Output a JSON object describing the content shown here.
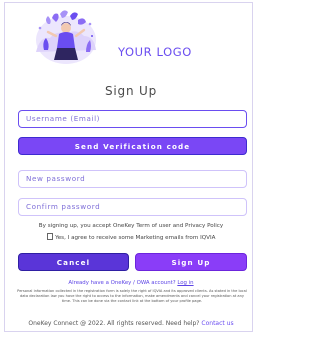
{
  "logo": {
    "text": "YOUR LOGO",
    "illustration": "person-with-plants-illustration",
    "accent_color": "#6a4df0"
  },
  "form": {
    "title": "Sign Up",
    "username_placeholder": "Username (Email)",
    "send_code_label": "Send Verification code",
    "new_password_placeholder": "New password",
    "confirm_password_placeholder": "Confirm password",
    "terms_text": "By signing up, you accept OneKey Term of user and Privacy Policy",
    "marketing_text": "Yes, I agree to receive some Marketing emails from IQVIA",
    "cancel_label": "Cancel",
    "signup_label": "Sign Up"
  },
  "links": {
    "already_prefix": "Already have a OneKey / OWA account? ",
    "login_label": "Log in"
  },
  "fine_print": "Personal information collected in the registration form is solely the right of IQVIA and its approved clients. As stated in the local data declaration law you have the right to access to the information, make amendments and cancel your registration at any time. This can be done via the contact link at the bottom of your profile page.",
  "footer": {
    "text": "OneKey Connect @ 2022. All rights reserved. Need help? ",
    "contact_label": "Contact us"
  },
  "colors": {
    "primary": "#7a47f5",
    "cancel": "#5a35d8",
    "signup": "#8a3df8",
    "input_border": "#cfc3fa"
  }
}
